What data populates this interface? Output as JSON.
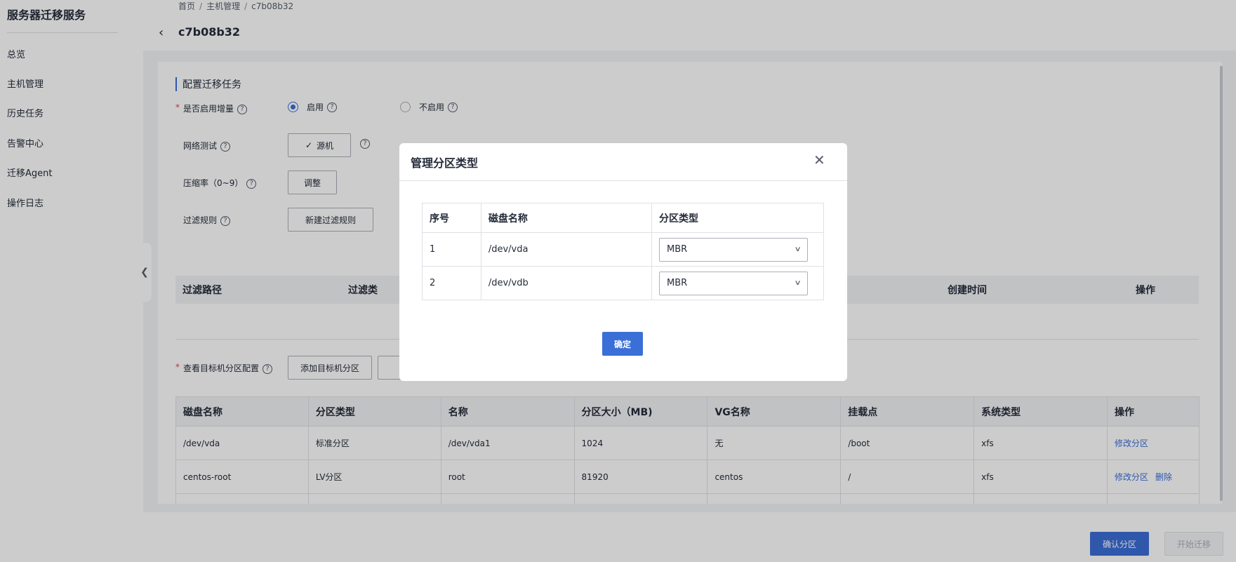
{
  "app": {
    "title": "服务器迁移服务"
  },
  "sidebar": {
    "items": [
      {
        "label": "总览"
      },
      {
        "label": "主机管理"
      },
      {
        "label": "历史任务"
      },
      {
        "label": "告警中心"
      },
      {
        "label": "迁移Agent"
      },
      {
        "label": "操作日志"
      }
    ]
  },
  "breadcrumb": {
    "home": "首页",
    "hosts": "主机管理",
    "current": "c7b08b32"
  },
  "page": {
    "title": "c7b08b32"
  },
  "config": {
    "section_title": "配置迁移任务",
    "incremental": {
      "label": "是否启用增量",
      "enabled_label": "启用",
      "disabled_label": "不启用"
    },
    "network_test": {
      "label": "网络测试",
      "button": "源机"
    },
    "compression": {
      "label": "压缩率（0~9）",
      "button": "调整"
    },
    "filter": {
      "label": "过滤规则",
      "button": "新建过滤规则"
    },
    "filter_table": {
      "headers": [
        "过滤路径",
        "过滤类",
        "创建时间",
        "操作"
      ]
    },
    "partition": {
      "label": "查看目标机分区配置",
      "add_button": "添加目标机分区",
      "headers": [
        "磁盘名称",
        "分区类型",
        "名称",
        "分区大小（MB)",
        "VG名称",
        "挂载点",
        "系统类型",
        "操作"
      ],
      "rows": [
        {
          "disk": "/dev/vda",
          "type": "标准分区",
          "name": "/dev/vda1",
          "size": "1024",
          "vg": "无",
          "mount": "/boot",
          "fs": "xfs",
          "edit": "修改分区",
          "delete": ""
        },
        {
          "disk": "centos-root",
          "type": "LV分区",
          "name": "root",
          "size": "81920",
          "vg": "centos",
          "mount": "/",
          "fs": "xfs",
          "edit": "修改分区",
          "delete": "删除"
        }
      ]
    }
  },
  "footer": {
    "confirm_partition": "确认分区",
    "start_migration": "开始迁移"
  },
  "modal": {
    "title": "管理分区类型",
    "headers": [
      "序号",
      "磁盘名称",
      "分区类型"
    ],
    "rows": [
      {
        "index": "1",
        "disk": "/dev/vda",
        "type": "MBR"
      },
      {
        "index": "2",
        "disk": "/dev/vdb",
        "type": "MBR"
      }
    ],
    "ok": "确定"
  },
  "colors": {
    "primary": "#3b6fd8",
    "required": "#e54545",
    "mask": "rgba(0,0,0,0.2)"
  }
}
